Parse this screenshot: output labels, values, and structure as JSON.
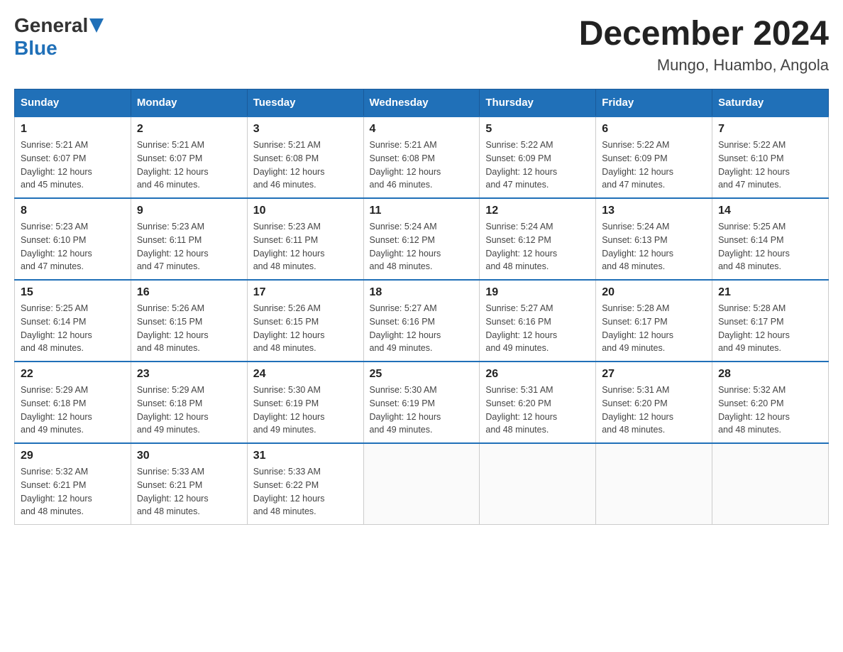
{
  "logo": {
    "general": "General",
    "blue": "Blue"
  },
  "title": "December 2024",
  "location": "Mungo, Huambo, Angola",
  "days_of_week": [
    "Sunday",
    "Monday",
    "Tuesday",
    "Wednesday",
    "Thursday",
    "Friday",
    "Saturday"
  ],
  "weeks": [
    [
      {
        "day": "1",
        "sunrise": "5:21 AM",
        "sunset": "6:07 PM",
        "daylight": "12 hours and 45 minutes."
      },
      {
        "day": "2",
        "sunrise": "5:21 AM",
        "sunset": "6:07 PM",
        "daylight": "12 hours and 46 minutes."
      },
      {
        "day": "3",
        "sunrise": "5:21 AM",
        "sunset": "6:08 PM",
        "daylight": "12 hours and 46 minutes."
      },
      {
        "day": "4",
        "sunrise": "5:21 AM",
        "sunset": "6:08 PM",
        "daylight": "12 hours and 46 minutes."
      },
      {
        "day": "5",
        "sunrise": "5:22 AM",
        "sunset": "6:09 PM",
        "daylight": "12 hours and 47 minutes."
      },
      {
        "day": "6",
        "sunrise": "5:22 AM",
        "sunset": "6:09 PM",
        "daylight": "12 hours and 47 minutes."
      },
      {
        "day": "7",
        "sunrise": "5:22 AM",
        "sunset": "6:10 PM",
        "daylight": "12 hours and 47 minutes."
      }
    ],
    [
      {
        "day": "8",
        "sunrise": "5:23 AM",
        "sunset": "6:10 PM",
        "daylight": "12 hours and 47 minutes."
      },
      {
        "day": "9",
        "sunrise": "5:23 AM",
        "sunset": "6:11 PM",
        "daylight": "12 hours and 47 minutes."
      },
      {
        "day": "10",
        "sunrise": "5:23 AM",
        "sunset": "6:11 PM",
        "daylight": "12 hours and 48 minutes."
      },
      {
        "day": "11",
        "sunrise": "5:24 AM",
        "sunset": "6:12 PM",
        "daylight": "12 hours and 48 minutes."
      },
      {
        "day": "12",
        "sunrise": "5:24 AM",
        "sunset": "6:12 PM",
        "daylight": "12 hours and 48 minutes."
      },
      {
        "day": "13",
        "sunrise": "5:24 AM",
        "sunset": "6:13 PM",
        "daylight": "12 hours and 48 minutes."
      },
      {
        "day": "14",
        "sunrise": "5:25 AM",
        "sunset": "6:14 PM",
        "daylight": "12 hours and 48 minutes."
      }
    ],
    [
      {
        "day": "15",
        "sunrise": "5:25 AM",
        "sunset": "6:14 PM",
        "daylight": "12 hours and 48 minutes."
      },
      {
        "day": "16",
        "sunrise": "5:26 AM",
        "sunset": "6:15 PM",
        "daylight": "12 hours and 48 minutes."
      },
      {
        "day": "17",
        "sunrise": "5:26 AM",
        "sunset": "6:15 PM",
        "daylight": "12 hours and 48 minutes."
      },
      {
        "day": "18",
        "sunrise": "5:27 AM",
        "sunset": "6:16 PM",
        "daylight": "12 hours and 49 minutes."
      },
      {
        "day": "19",
        "sunrise": "5:27 AM",
        "sunset": "6:16 PM",
        "daylight": "12 hours and 49 minutes."
      },
      {
        "day": "20",
        "sunrise": "5:28 AM",
        "sunset": "6:17 PM",
        "daylight": "12 hours and 49 minutes."
      },
      {
        "day": "21",
        "sunrise": "5:28 AM",
        "sunset": "6:17 PM",
        "daylight": "12 hours and 49 minutes."
      }
    ],
    [
      {
        "day": "22",
        "sunrise": "5:29 AM",
        "sunset": "6:18 PM",
        "daylight": "12 hours and 49 minutes."
      },
      {
        "day": "23",
        "sunrise": "5:29 AM",
        "sunset": "6:18 PM",
        "daylight": "12 hours and 49 minutes."
      },
      {
        "day": "24",
        "sunrise": "5:30 AM",
        "sunset": "6:19 PM",
        "daylight": "12 hours and 49 minutes."
      },
      {
        "day": "25",
        "sunrise": "5:30 AM",
        "sunset": "6:19 PM",
        "daylight": "12 hours and 49 minutes."
      },
      {
        "day": "26",
        "sunrise": "5:31 AM",
        "sunset": "6:20 PM",
        "daylight": "12 hours and 48 minutes."
      },
      {
        "day": "27",
        "sunrise": "5:31 AM",
        "sunset": "6:20 PM",
        "daylight": "12 hours and 48 minutes."
      },
      {
        "day": "28",
        "sunrise": "5:32 AM",
        "sunset": "6:20 PM",
        "daylight": "12 hours and 48 minutes."
      }
    ],
    [
      {
        "day": "29",
        "sunrise": "5:32 AM",
        "sunset": "6:21 PM",
        "daylight": "12 hours and 48 minutes."
      },
      {
        "day": "30",
        "sunrise": "5:33 AM",
        "sunset": "6:21 PM",
        "daylight": "12 hours and 48 minutes."
      },
      {
        "day": "31",
        "sunrise": "5:33 AM",
        "sunset": "6:22 PM",
        "daylight": "12 hours and 48 minutes."
      },
      null,
      null,
      null,
      null
    ]
  ],
  "labels": {
    "sunrise": "Sunrise:",
    "sunset": "Sunset:",
    "daylight": "Daylight:"
  }
}
